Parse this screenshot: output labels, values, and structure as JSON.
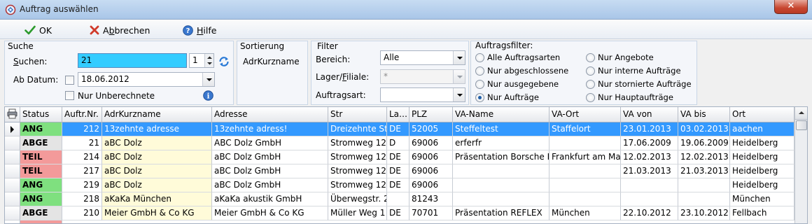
{
  "window": {
    "title": "Auftrag auswählen",
    "close_glyph": "✕"
  },
  "toolbar": {
    "ok": "OK",
    "cancel_prefix": "A",
    "cancel_key": "b",
    "cancel_suffix": "brechen",
    "help_prefix": "",
    "help_key": "H",
    "help_suffix": "ilfe"
  },
  "suche": {
    "title": "Suche",
    "search_label_key": "S",
    "search_label_rest": "uchen:",
    "search_value": "21",
    "count_value": "1",
    "date_label": "Ab Datum:",
    "date_value": "18.06.2012",
    "unbilled_label": "Nur Unberechnete"
  },
  "sortierung": {
    "title": "Sortierung",
    "value": "AdrKurzname"
  },
  "filter": {
    "title": "Filter",
    "bereich_label": "Bereich:",
    "bereich_value": "Alle",
    "lager_label_a": "Lager/",
    "lager_label_key": "F",
    "lager_label_b": "iliale:",
    "lager_value": "*",
    "auftragsart_label": "Auftragsart:",
    "auftragsart_value": ""
  },
  "auftragsfilter": {
    "title": "Auftragsfilter:",
    "options": [
      {
        "label": "Alle Auftragsarten",
        "selected": false
      },
      {
        "label": "Nur abgeschlossene",
        "selected": false
      },
      {
        "label": "Nur ausgegebene",
        "selected": false
      },
      {
        "label": "Nur Aufträge",
        "selected": true
      },
      {
        "label": "Nur Angebote",
        "selected": false
      },
      {
        "label": "Nur interne Aufträge",
        "selected": false
      },
      {
        "label": "Nur stornierte Aufträge",
        "selected": false
      },
      {
        "label": "Nur Hauptaufträge",
        "selected": false
      }
    ]
  },
  "table": {
    "columns": [
      "Status",
      "Auftr.Nr.",
      "AdrKurzname",
      "Adresse",
      "Str",
      "La…",
      "PLZ",
      "VA-Name",
      "VA-Ort",
      "VA von",
      "VA bis",
      "Ort"
    ],
    "rows": [
      [
        "ANG",
        "212",
        "13zehnte adresse",
        "13zehnte adress!",
        "Dreizehnte St",
        "DE",
        "52005",
        "Steffeltest",
        "Staffelort",
        "23.01.2013",
        "03.02.2013",
        "aachen"
      ],
      [
        "ABGE",
        "21",
        "aBC Dolz",
        "ABC Dolz GmbH",
        "Stromweg 12",
        "D",
        "69006",
        "erferfr",
        "",
        "17.06.2009",
        "19.06.2009",
        "Heidelberg"
      ],
      [
        "TEIL",
        "214",
        "aBC Dolz",
        "aBC Dolz GmbH",
        "Stromweg 12",
        "DE",
        "69006",
        "Präsentation Borsche D",
        "Frankfurt am Mai",
        "12.02.2013",
        "12.02.2013",
        "Heidelberg"
      ],
      [
        "TEIL",
        "217",
        "aBC Dolz",
        "aBC Dolz GmbH",
        "Stromweg 12",
        "DE",
        "69006",
        "",
        "",
        "21.03.2013",
        "21.03.2013",
        "Heidelberg"
      ],
      [
        "ANG",
        "219",
        "aBC Dolz",
        "aBC Dolz GmbH",
        "Stromweg 12",
        "DE",
        "69006",
        "",
        "",
        "",
        "",
        "Heidelberg"
      ],
      [
        "ANG",
        "218",
        "aKaKa München",
        "aKaKa akustik GmbH",
        "Überwegstr. 2",
        "",
        "81243",
        "",
        "",
        "",
        "",
        "München"
      ],
      [
        "ABGE",
        "210",
        "Meier GmbH & Co KG",
        "Meier GmbH & Co KG",
        "Müller Weg 1",
        "DE",
        "70701",
        "Präsentation REFLEX",
        "München",
        "22.10.2012",
        "23.10.2012",
        "Fellbach"
      ]
    ],
    "selected_row": 0
  },
  "colors": {
    "status_ANG": "#7fe07f",
    "status_ABGE": "#e4e4e4",
    "status_TEIL": "#f39a9a",
    "adr_column": "#fffbd9",
    "selection": "#3399ff",
    "search_highlight": "#33ccff"
  }
}
